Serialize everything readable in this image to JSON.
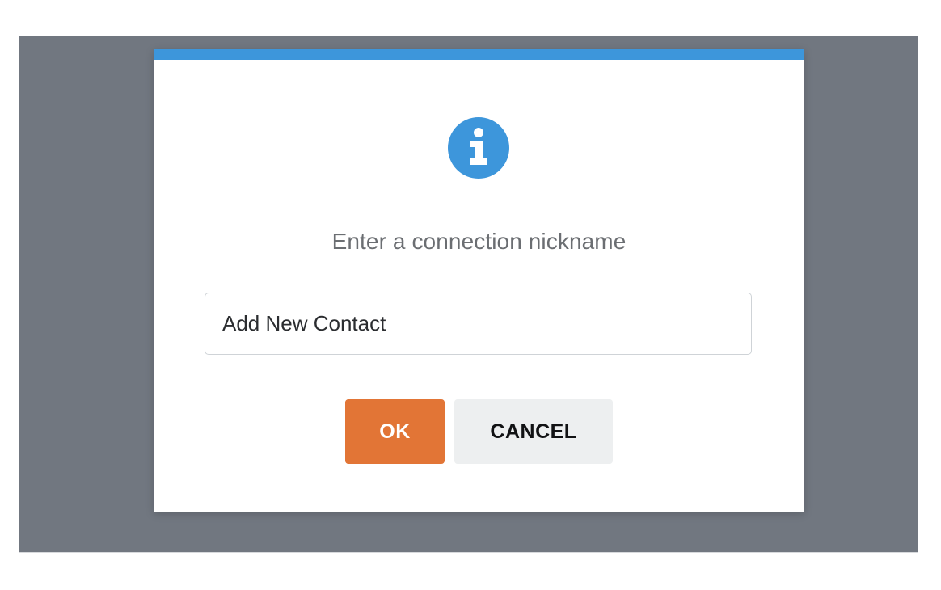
{
  "dialog": {
    "accent_color": "#3d96db",
    "icon": "info-circle-icon",
    "message": "Enter a connection nickname",
    "input": {
      "value": "Add New Contact",
      "placeholder": ""
    },
    "buttons": {
      "ok_label": "OK",
      "ok_color": "#e27536",
      "cancel_label": "CANCEL",
      "cancel_color": "#edeff0"
    }
  },
  "backdrop_color": "#717780"
}
